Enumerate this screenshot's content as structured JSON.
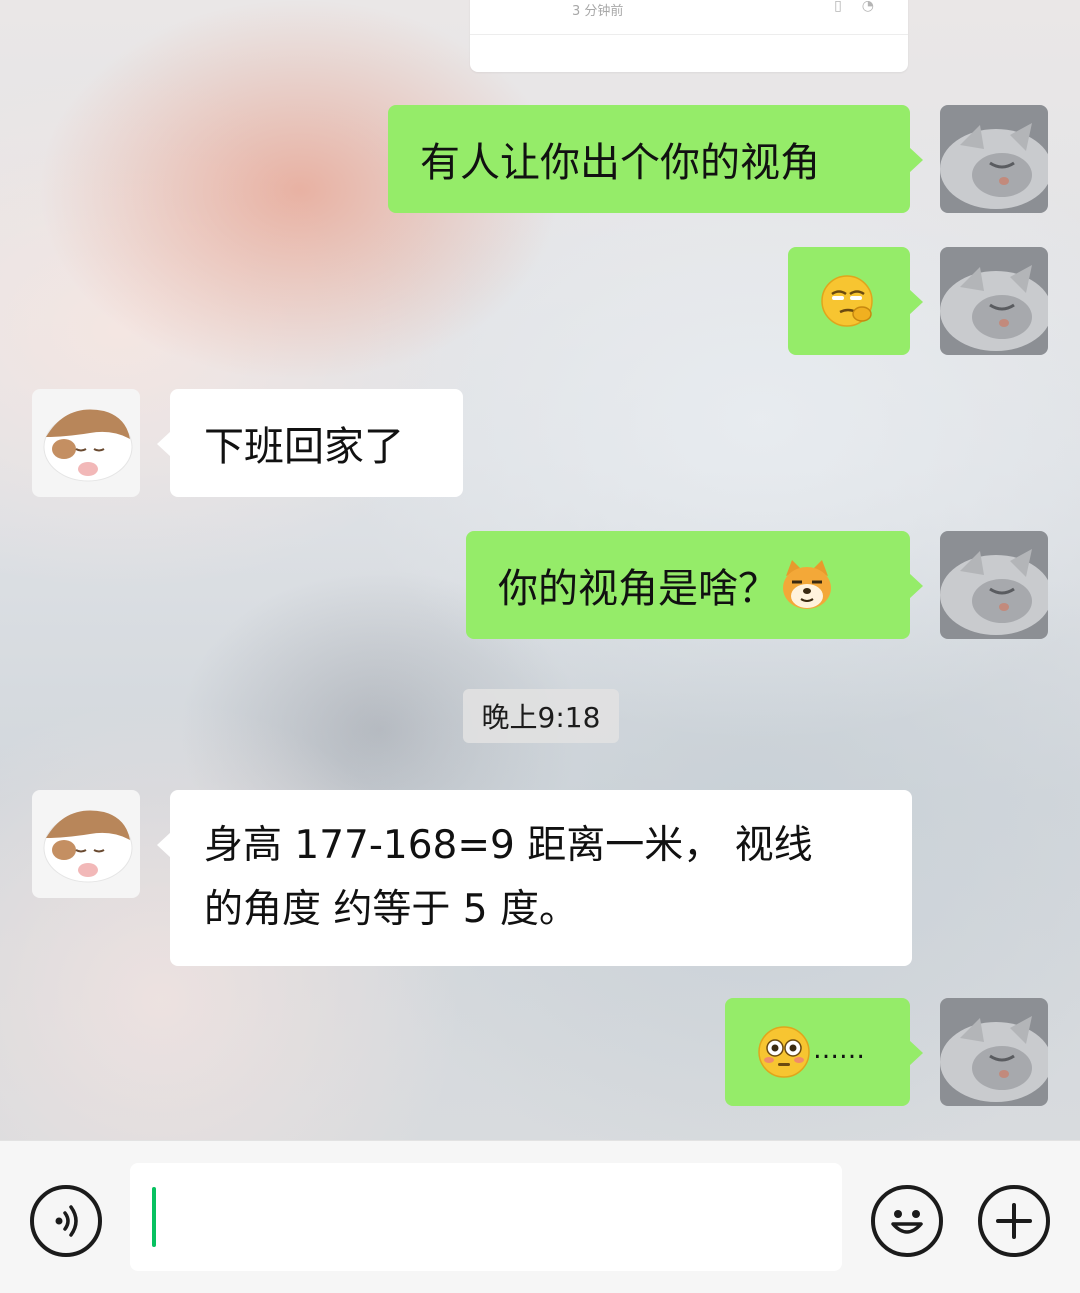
{
  "moment_card": {
    "time_label": "3 分钟前"
  },
  "timestamp": "晚上9:18",
  "messages": [
    {
      "from": "me",
      "text": "有人让你出个你的视角"
    },
    {
      "from": "me",
      "emoji": "smirk-hand-emoji"
    },
    {
      "from": "other",
      "text": "下班回家了"
    },
    {
      "from": "me",
      "text": "你的视角是啥？",
      "emoji": "doge-emoji"
    },
    {
      "from": "other",
      "line1": "身高 177-168=9 距离一米， 视线",
      "line2": "的角度 约等于 5 度。"
    },
    {
      "from": "me",
      "emoji": "flushed-emoji",
      "text": "……"
    }
  ],
  "colors": {
    "my_bubble": "#95ec69",
    "other_bubble": "#ffffff",
    "cursor": "#07c160"
  },
  "input_bar": {
    "voice_icon": "voice-icon",
    "emoji_icon": "emoji-icon",
    "add_icon": "plus-icon",
    "input_value": ""
  }
}
